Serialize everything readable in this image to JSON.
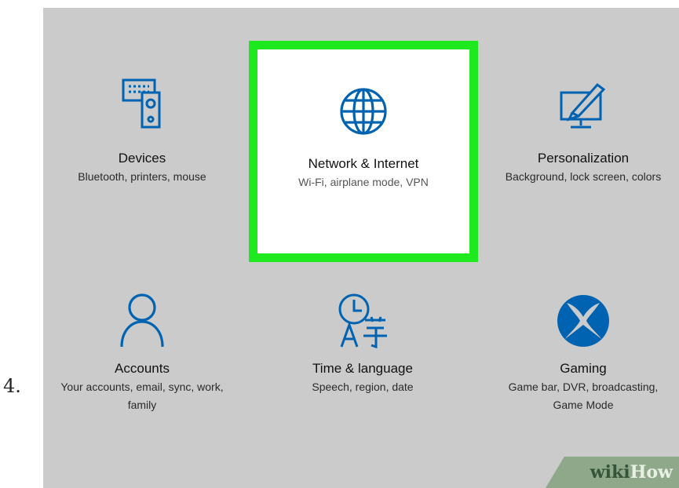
{
  "step": {
    "number": "4."
  },
  "settings": {
    "tiles": [
      {
        "title": "Devices",
        "description": "Bluetooth, printers, mouse",
        "icon": "devices-icon"
      },
      {
        "title": "Network & Internet",
        "description": "Wi-Fi, airplane mode, VPN",
        "icon": "globe-icon",
        "highlighted": true
      },
      {
        "title": "Personalization",
        "description": "Background, lock screen, colors",
        "icon": "personalization-icon"
      },
      {
        "title": "Accounts",
        "description": "Your accounts, email, sync, work, family",
        "icon": "person-icon"
      },
      {
        "title": "Time & language",
        "description": "Speech, region, date",
        "icon": "time-language-icon"
      },
      {
        "title": "Gaming",
        "description": "Game bar, DVR, broadcasting, Game Mode",
        "icon": "xbox-icon"
      }
    ]
  },
  "watermark": {
    "wiki": "wiki",
    "how": "How"
  },
  "colors": {
    "accent": "#0063b1",
    "highlight_border": "#1ee81e",
    "panel_background": "#cbcbcb"
  }
}
